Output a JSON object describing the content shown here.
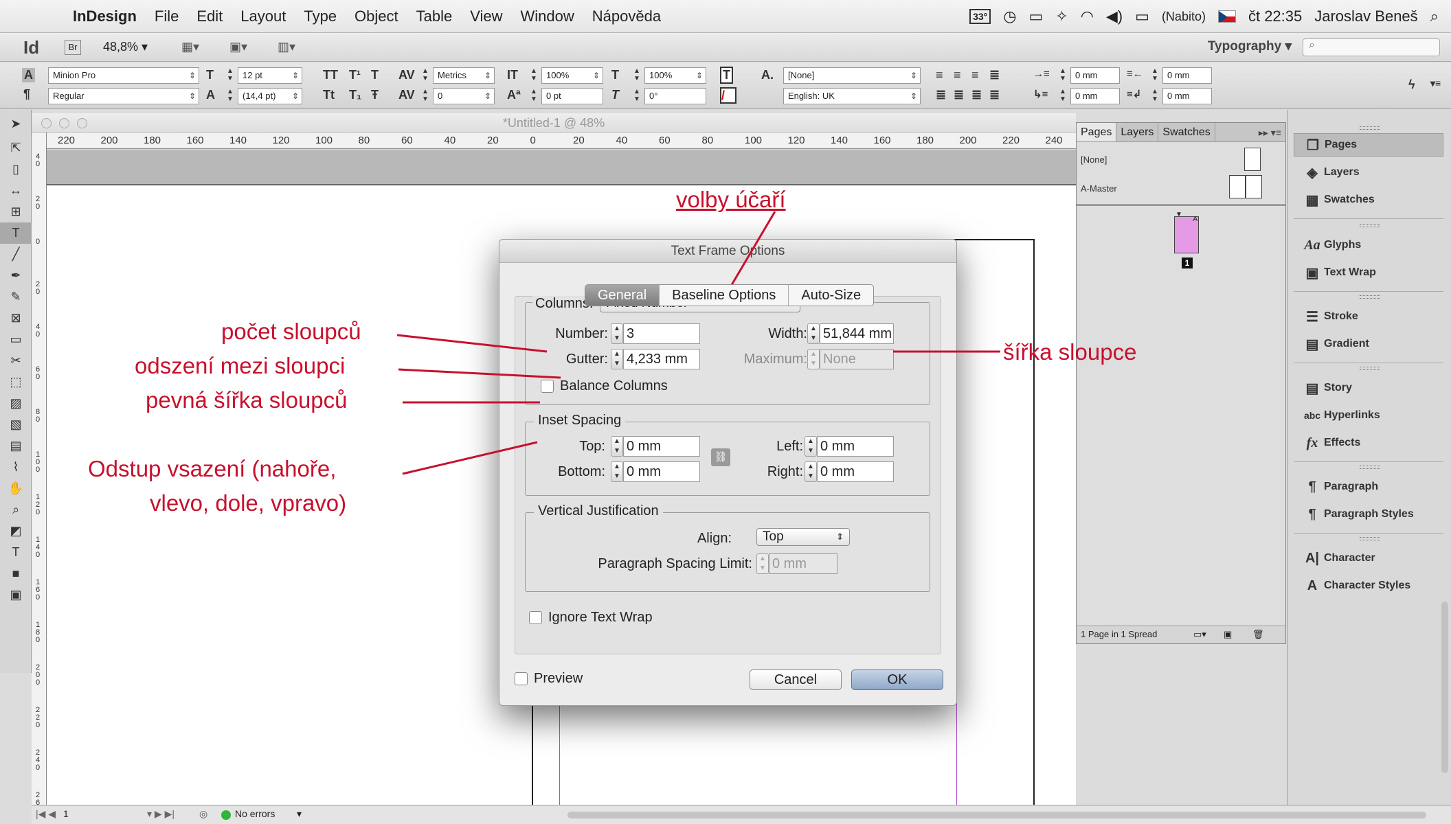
{
  "menubar": {
    "app": "InDesign",
    "items": [
      "File",
      "Edit",
      "Layout",
      "Type",
      "Object",
      "Table",
      "View",
      "Window",
      "Nápověda"
    ],
    "temp": "33°",
    "battery": "(Nabito)",
    "clock": "čt 22:35",
    "user": "Jaroslav Beneš"
  },
  "appbar": {
    "logo": "Id",
    "bridge": "Br",
    "zoom": "48,8% ▾",
    "workspace": "Typography ▾"
  },
  "control": {
    "font": "Minion Pro",
    "style": "Regular",
    "size": "12 pt",
    "leading": "(14,4 pt)",
    "kerning": "Metrics",
    "tracking": "0",
    "vscale": "100%",
    "hscale": "100%",
    "baseline": "0 pt",
    "skew": "0°",
    "charstyle": "[None]",
    "language": "English: UK",
    "indent_left": "0 mm",
    "indent_right": "0 mm",
    "indent_first": "0 mm",
    "indent_last": "0 mm"
  },
  "document": {
    "title": "*Untitled-1 @ 48%",
    "hruler": [
      "220",
      "200",
      "180",
      "160",
      "140",
      "120",
      "100",
      "80",
      "60",
      "40",
      "20",
      "0",
      "20",
      "40",
      "60",
      "80",
      "100",
      "120",
      "140",
      "160",
      "180",
      "200",
      "220",
      "240"
    ],
    "vruler": [
      "40",
      "20",
      "0",
      "20",
      "40",
      "60",
      "80",
      "100",
      "120",
      "140",
      "160",
      "180",
      "200",
      "220",
      "240",
      "260"
    ]
  },
  "status": {
    "page": "1",
    "errors": "No errors"
  },
  "annotations": {
    "baseline": "volby účaří",
    "count": "počet sloupců",
    "gutter": "odszení mezi sloupci",
    "fixed": "pevná šířka sloupců",
    "inset_1": "Odstup vsazení (nahoře,",
    "inset_2": "vlevo, dole, vpravo)",
    "width": "šířka sloupce"
  },
  "dialog": {
    "title": "Text Frame Options",
    "tabs": [
      "General",
      "Baseline Options",
      "Auto-Size"
    ],
    "columns_label": "Columns:",
    "columns_value": "Fixed Number",
    "number_label": "Number:",
    "number_value": "3",
    "width_label": "Width:",
    "width_value": "51,844 mm",
    "gutter_label": "Gutter:",
    "gutter_value": "4,233 mm",
    "maximum_label": "Maximum:",
    "maximum_value": "None",
    "balance": "Balance Columns",
    "inset_title": "Inset Spacing",
    "top_label": "Top:",
    "top_value": "0 mm",
    "bottom_label": "Bottom:",
    "bottom_value": "0 mm",
    "left_label": "Left:",
    "left_value": "0 mm",
    "right_label": "Right:",
    "right_value": "0 mm",
    "vj_title": "Vertical Justification",
    "align_label": "Align:",
    "align_value": "Top",
    "psl_label": "Paragraph Spacing Limit:",
    "psl_value": "0 mm",
    "ignore_wrap": "Ignore Text Wrap",
    "preview": "Preview",
    "cancel": "Cancel",
    "ok": "OK"
  },
  "pages_panel": {
    "tabs": [
      "Pages",
      "Layers",
      "Swatches"
    ],
    "none": "[None]",
    "master": "A-Master",
    "page_letter": "A",
    "page_number": "1",
    "footer": "1 Page in 1 Spread"
  },
  "dock": {
    "items": [
      "Pages",
      "Layers",
      "Swatches",
      "Glyphs",
      "Text Wrap",
      "Stroke",
      "Gradient",
      "Story",
      "Hyperlinks",
      "Effects",
      "Paragraph",
      "Paragraph Styles",
      "Character",
      "Character Styles"
    ]
  },
  "colors": {
    "annotation": "#c8102e",
    "margin_guide": "#b34bd6",
    "page_thumb": "#e59ae6"
  }
}
